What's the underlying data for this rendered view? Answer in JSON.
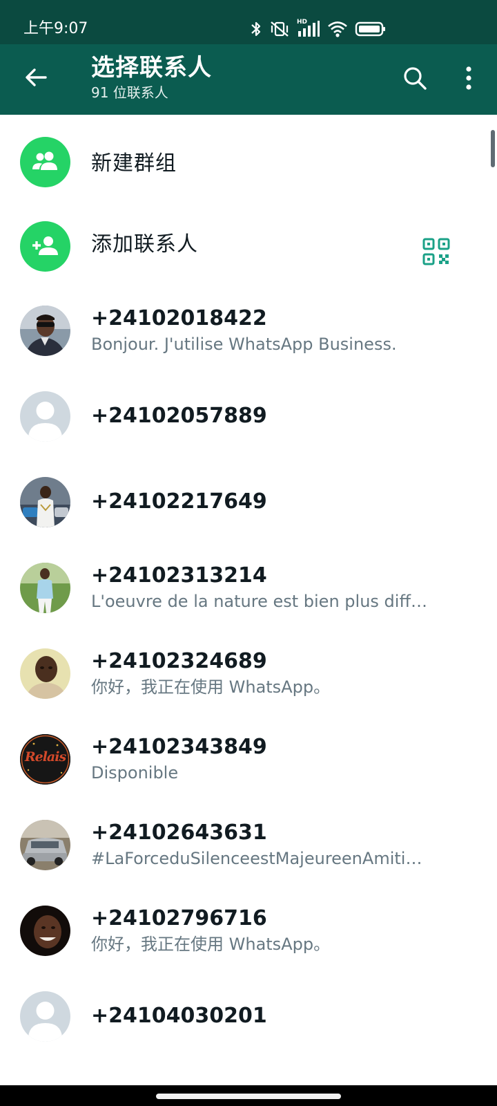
{
  "status_bar": {
    "time": "上午9:07",
    "icons": [
      "bluetooth-icon",
      "vibrate-mute-icon",
      "hd-signal-icon",
      "wifi-icon",
      "battery-icon"
    ],
    "hd_label": "HD"
  },
  "app_bar": {
    "title": "选择联系人",
    "subtitle": "91 位联系人",
    "colors": {
      "status": "#0b4a40",
      "bar": "#0b5c50"
    }
  },
  "actions": [
    {
      "label": "新建群组",
      "icon": "group-icon"
    },
    {
      "label": "添加联系人",
      "icon": "add-person-icon"
    }
  ],
  "accent": "#25d366",
  "contacts": [
    {
      "name": "+24102018422",
      "status": "Bonjour. J'utilise WhatsApp Business.",
      "avatar": "photo"
    },
    {
      "name": "+24102057889",
      "status": "",
      "avatar": "default"
    },
    {
      "name": "+24102217649",
      "status": "",
      "avatar": "photo"
    },
    {
      "name": "+24102313214",
      "status": "L'oeuvre de la nature est bien plus diff…",
      "avatar": "photo"
    },
    {
      "name": "+24102324689",
      "status": "你好，我正在使用 WhatsApp。",
      "avatar": "photo"
    },
    {
      "name": "+24102343849",
      "status": "Disponible",
      "avatar": "logo"
    },
    {
      "name": "+24102643631",
      "status": "#LaForceduSilenceestMajeureenAmiti…",
      "avatar": "photo"
    },
    {
      "name": "+24102796716",
      "status": "你好，我正在使用 WhatsApp。",
      "avatar": "photo"
    },
    {
      "name": "+24104030201",
      "status": "",
      "avatar": "default"
    }
  ],
  "logo_text": "Relais"
}
